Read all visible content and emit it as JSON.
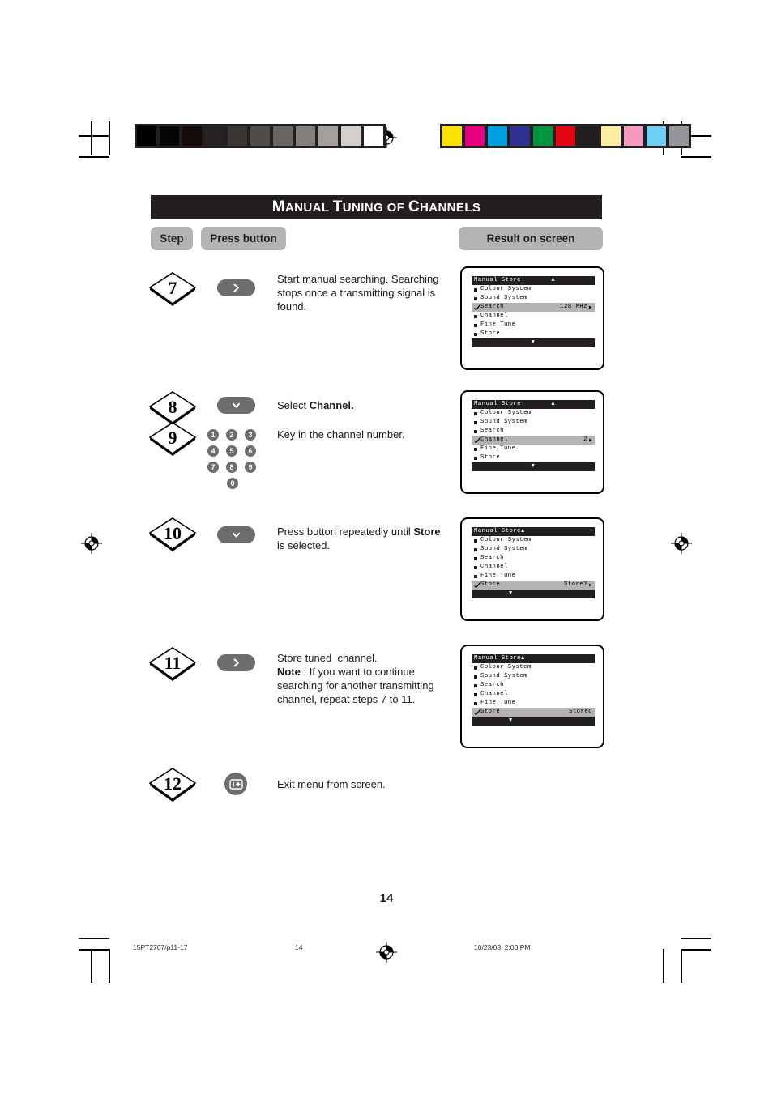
{
  "page": {
    "title_parts": [
      {
        "text": "M",
        "big": true
      },
      {
        "text": "ANUAL ",
        "big": false
      },
      {
        "text": "T",
        "big": true
      },
      {
        "text": "UNING OF ",
        "big": false
      },
      {
        "text": "C",
        "big": true
      },
      {
        "text": "HANNELS",
        "big": false
      }
    ],
    "title_plain": "MANUAL TUNING OF CHANNELS",
    "page_number": "14"
  },
  "headers": {
    "step": "Step",
    "press_button": "Press button",
    "result_on_screen": "Result on screen"
  },
  "steps": [
    {
      "number": "7",
      "button": "right-arrow",
      "text_html": "Start manual searching. Searching stops once a transmitting signal is found.",
      "text_plain": "Start manual searching. Searching stops once a transmitting signal is found."
    },
    {
      "number": "8",
      "button": "chevron-down",
      "text_plain": "Select Channel."
    },
    {
      "number": "9",
      "button": "numeric-keypad",
      "text_plain": "Key in the channel number."
    },
    {
      "number": "10",
      "button": "chevron-down",
      "text_plain": "Press button repeatedly until Store is selected."
    },
    {
      "number": "11",
      "button": "right-arrow",
      "text_plain": "Store tuned  channel. Note : If you want to continue searching for another transmitting channel, repeat steps 7 to 11."
    },
    {
      "number": "12",
      "button": "menu-exit",
      "text_plain": "Exit menu from screen."
    }
  ],
  "keypad": {
    "rows": [
      [
        "1",
        "2",
        "3"
      ],
      [
        "4",
        "5",
        "6"
      ],
      [
        "7",
        "8",
        "9"
      ]
    ],
    "zero": "0"
  },
  "osd_screens": [
    {
      "id": "screen-step7",
      "title": "Manual Store",
      "up_arrow": "▲",
      "down_arrow": "▼",
      "rows": [
        {
          "label": "Colour System",
          "value": "",
          "selected": false,
          "checked": false
        },
        {
          "label": "Sound System",
          "value": "",
          "selected": false,
          "checked": false
        },
        {
          "label": "Search",
          "value": "128 MHz",
          "selected": true,
          "checked": true,
          "arrow": "▶"
        },
        {
          "label": "Channel",
          "value": "",
          "selected": false,
          "checked": false
        },
        {
          "label": "Fine Tune",
          "value": "",
          "selected": false,
          "checked": false
        },
        {
          "label": "Store",
          "value": "",
          "selected": false,
          "checked": false
        }
      ]
    },
    {
      "id": "screen-step8",
      "title": "Manual Store",
      "up_arrow": "▲",
      "down_arrow": "▼",
      "rows": [
        {
          "label": "Colour System",
          "value": "",
          "selected": false,
          "checked": false
        },
        {
          "label": "Sound System",
          "value": "",
          "selected": false,
          "checked": false
        },
        {
          "label": "Search",
          "value": "",
          "selected": false,
          "checked": false
        },
        {
          "label": "Channel",
          "value": "2",
          "selected": true,
          "checked": true,
          "arrow": "▶"
        },
        {
          "label": "Fine Tune",
          "value": "",
          "selected": false,
          "checked": false
        },
        {
          "label": "Store",
          "value": "",
          "selected": false,
          "checked": false
        }
      ]
    },
    {
      "id": "screen-step10",
      "title": "Manual Store",
      "up_arrow": "▲",
      "down_arrow": "▼",
      "tight": true,
      "rows": [
        {
          "label": "Colour System",
          "value": "",
          "selected": false,
          "checked": false
        },
        {
          "label": "Sound System",
          "value": "",
          "selected": false,
          "checked": false
        },
        {
          "label": "Search",
          "value": "",
          "selected": false,
          "checked": false
        },
        {
          "label": "Channel",
          "value": "",
          "selected": false,
          "checked": false
        },
        {
          "label": "Fine Tune",
          "value": "",
          "selected": false,
          "checked": false
        },
        {
          "label": "Store",
          "value": "Store?",
          "selected": true,
          "checked": true,
          "arrow": "▶"
        }
      ]
    },
    {
      "id": "screen-step11",
      "title": "Manual Store",
      "up_arrow": "▲",
      "down_arrow": "▼",
      "tight": true,
      "rows": [
        {
          "label": "Colour System",
          "value": "",
          "selected": false,
          "checked": false
        },
        {
          "label": "Sound System",
          "value": "",
          "selected": false,
          "checked": false
        },
        {
          "label": "Search",
          "value": "",
          "selected": false,
          "checked": false
        },
        {
          "label": "Channel",
          "value": "",
          "selected": false,
          "checked": false
        },
        {
          "label": "Fine Tune",
          "value": "",
          "selected": false,
          "checked": false
        },
        {
          "label": "Store",
          "value": "Stored",
          "selected": true,
          "checked": true,
          "arrow": ""
        }
      ]
    }
  ],
  "calibration": {
    "grayscale": [
      "#000000",
      "#050505",
      "#130c0b",
      "#262222",
      "#3b3634",
      "#524c49",
      "#6b6562",
      "#857f7b",
      "#a6a09c",
      "#d2cfcc",
      "#ffffff"
    ],
    "colors": [
      "#fde100",
      "#e6007e",
      "#009fe3",
      "#2e3192",
      "#009640",
      "#e30613",
      "#231f20",
      "#fbeea2",
      "#f49ac1",
      "#6dcff6",
      "#939598"
    ]
  },
  "footer": {
    "left": "15PT2767/p11-17",
    "center": "14",
    "right": "10/23/03, 2:00 PM"
  }
}
